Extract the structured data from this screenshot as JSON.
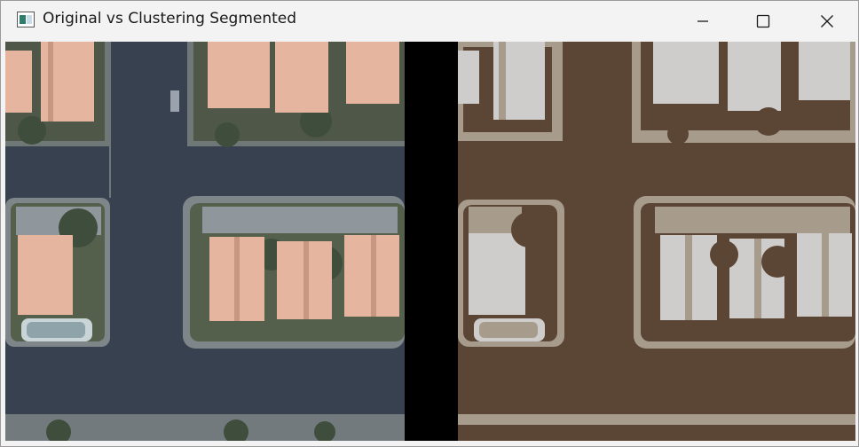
{
  "window": {
    "title": "Original vs Clustering Segmented",
    "controls": {
      "minimize_icon": "minimize-icon",
      "maximize_icon": "maximize-icon",
      "close_icon": "close-icon"
    }
  },
  "colors": {
    "titlebar_bg": "#f3f3f3",
    "road": "#37414f",
    "sidewalk": "#8f969c",
    "roof": "#e6b5a0",
    "vegetation": "#3e4d3c",
    "seg_dark": "#5b4535",
    "seg_mid": "#a79b8c",
    "seg_light": "#cfcdcb",
    "separator": "#000000"
  }
}
